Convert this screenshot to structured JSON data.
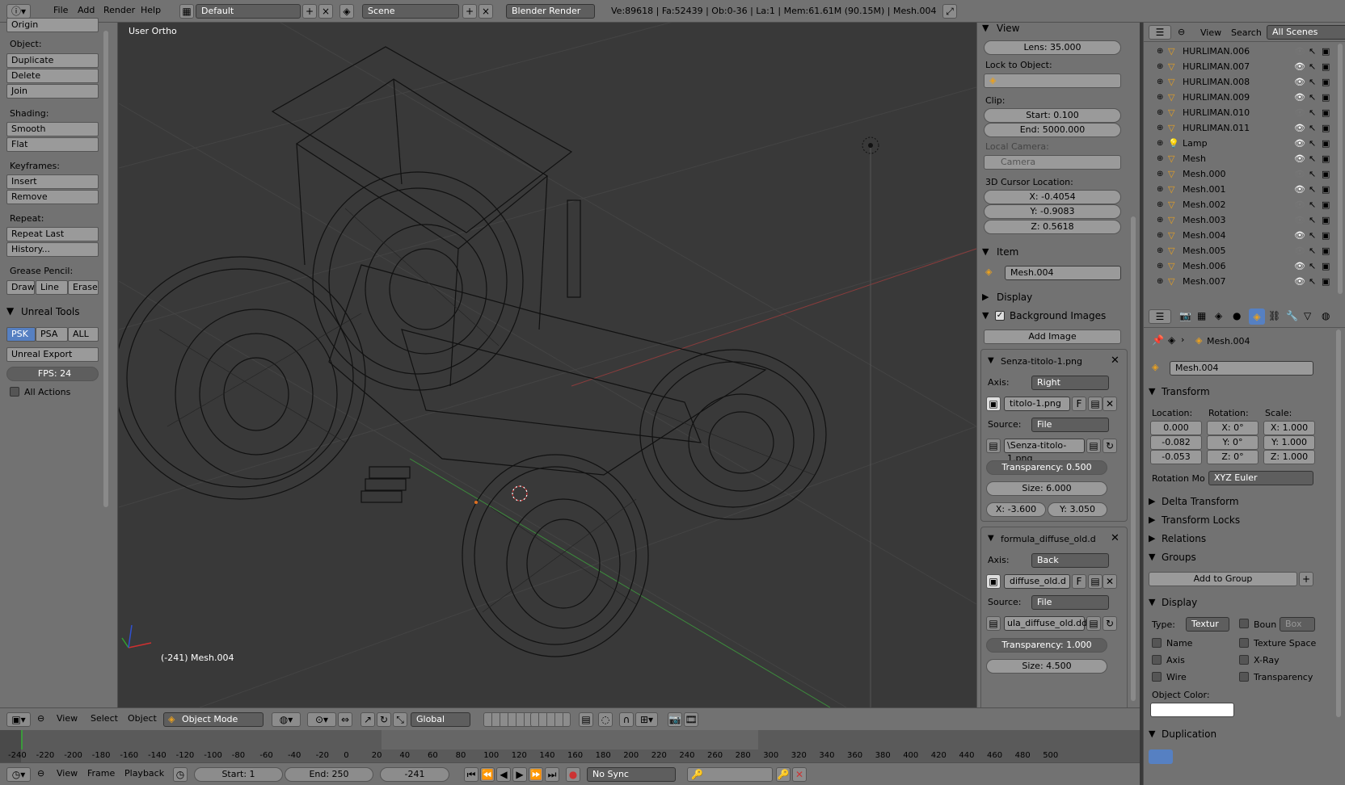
{
  "topbar": {
    "menus": [
      "File",
      "Add",
      "Render",
      "Help"
    ],
    "layout": "Default",
    "scene": "Scene",
    "engine": "Blender Render",
    "stats": "Ve:89618 | Fa:52439 | Ob:0-36 | La:1 | Mem:61.61M (90.15M) | Mesh.004"
  },
  "toolshelf": {
    "top_button": "Origin",
    "object_label": "Object:",
    "object_buttons": [
      "Duplicate",
      "Delete",
      "Join"
    ],
    "shading_label": "Shading:",
    "shading_buttons": [
      "Smooth",
      "Flat"
    ],
    "keyframes_label": "Keyframes:",
    "keyframe_buttons": [
      "Insert",
      "Remove"
    ],
    "repeat_label": "Repeat:",
    "repeat_buttons": [
      "Repeat Last",
      "History..."
    ],
    "grease_label": "Grease Pencil:",
    "grease_buttons": [
      "Draw",
      "Line",
      "Erase"
    ],
    "unreal_title": "Unreal Tools",
    "unreal_tabs": [
      "PSK",
      "PSA",
      "ALL"
    ],
    "unreal_export": "Unreal Export",
    "fps": "FPS: 24",
    "all_actions": "All Actions"
  },
  "viewport": {
    "view_name": "User Ortho",
    "object_info": "(-241) Mesh.004"
  },
  "npanel": {
    "view_title": "View",
    "lens": "Lens: 35.000",
    "lock_label": "Lock to Object:",
    "clip_label": "Clip:",
    "clip_start": "Start: 0.100",
    "clip_end": "End: 5000.000",
    "local_camera_label": "Local Camera:",
    "camera": "Camera",
    "cursor_label": "3D Cursor Location:",
    "cursor_x": "X: -0.4054",
    "cursor_y": "Y: -0.9083",
    "cursor_z": "Z: 0.5618",
    "item_title": "Item",
    "item_name": "Mesh.004",
    "display_title": "Display",
    "bg_title": "Background Images",
    "add_image": "Add Image",
    "bg1": {
      "name": "Senza-titolo-1.png",
      "axis_label": "Axis:",
      "axis": "Right",
      "image": "titolo-1.png",
      "f": "F",
      "source_label": "Source:",
      "source": "File",
      "path": "\\Senza-titolo-1.png",
      "transparency": "Transparency: 0.500",
      "size": "Size: 6.000",
      "x": "X: -3.600",
      "y": "Y: 3.050"
    },
    "bg2": {
      "name": "formula_diffuse_old.d",
      "axis_label": "Axis:",
      "axis": "Back",
      "image": "diffuse_old.d",
      "f": "F",
      "source_label": "Source:",
      "source": "File",
      "path": "ula_diffuse_old.dds",
      "transparency": "Transparency: 1.000",
      "size": "Size: 4.500"
    }
  },
  "outliner": {
    "menus": [
      "View",
      "Search"
    ],
    "filter": "All Scenes",
    "items": [
      {
        "name": "HURLIMAN.006",
        "icon": "mesh-object-icon",
        "visible": false
      },
      {
        "name": "HURLIMAN.007",
        "icon": "mesh-object-icon",
        "visible": true
      },
      {
        "name": "HURLIMAN.008",
        "icon": "mesh-object-icon",
        "visible": true
      },
      {
        "name": "HURLIMAN.009",
        "icon": "mesh-object-icon",
        "visible": true
      },
      {
        "name": "HURLIMAN.010",
        "icon": "mesh-object-icon",
        "visible": false
      },
      {
        "name": "HURLIMAN.011",
        "icon": "mesh-object-icon",
        "visible": true
      },
      {
        "name": "Lamp",
        "icon": "lamp-icon",
        "visible": true
      },
      {
        "name": "Mesh",
        "icon": "mesh-object-icon",
        "visible": true
      },
      {
        "name": "Mesh.000",
        "icon": "mesh-object-icon",
        "visible": false
      },
      {
        "name": "Mesh.001",
        "icon": "mesh-object-icon",
        "visible": true
      },
      {
        "name": "Mesh.002",
        "icon": "mesh-object-icon",
        "visible": false
      },
      {
        "name": "Mesh.003",
        "icon": "mesh-object-icon",
        "visible": false
      },
      {
        "name": "Mesh.004",
        "icon": "mesh-object-icon",
        "visible": true
      },
      {
        "name": "Mesh.005",
        "icon": "mesh-object-icon",
        "visible": false
      },
      {
        "name": "Mesh.006",
        "icon": "mesh-object-icon",
        "visible": true
      },
      {
        "name": "Mesh.007",
        "icon": "mesh-object-icon",
        "visible": true
      }
    ]
  },
  "properties": {
    "breadcrumb": "Mesh.004",
    "object_name": "Mesh.004",
    "transform_title": "Transform",
    "location_label": "Location:",
    "rotation_label": "Rotation:",
    "scale_label": "Scale:",
    "location": [
      "0.000",
      "-0.082",
      "-0.053"
    ],
    "rotation": [
      "X: 0°",
      "Y: 0°",
      "Z: 0°"
    ],
    "scale": [
      "X: 1.000",
      "Y: 1.000",
      "Z: 1.000"
    ],
    "rotation_mode_label": "Rotation Mo",
    "rotation_mode": "XYZ Euler",
    "delta_title": "Delta Transform",
    "locks_title": "Transform Locks",
    "relations_title": "Relations",
    "groups_title": "Groups",
    "add_to_group": "Add to Group",
    "display_title": "Display",
    "type_label": "Type:",
    "type_value": "Textur",
    "bounds_label": "Boun",
    "bounds_value": "Box",
    "name_check": "Name",
    "texture_space": "Texture Space",
    "axis_check": "Axis",
    "xray_check": "X-Ray",
    "wire_check": "Wire",
    "transparency_check": "Transparency",
    "object_color_label": "Object Color:",
    "duplication_title": "Duplication"
  },
  "view_header": {
    "menus": [
      "View",
      "Select",
      "Object"
    ],
    "mode": "Object Mode",
    "orientation": "Global"
  },
  "timeline": {
    "ticks": [
      "-240",
      "-220",
      "-200",
      "-180",
      "-160",
      "-140",
      "-120",
      "-100",
      "-80",
      "-60",
      "-40",
      "-20",
      "0",
      "20",
      "40",
      "60",
      "80",
      "100",
      "120",
      "140",
      "160",
      "180",
      "200",
      "220",
      "240",
      "260",
      "280",
      "300",
      "320",
      "340",
      "360",
      "380",
      "400",
      "420",
      "440",
      "460",
      "480",
      "500"
    ],
    "menus": [
      "View",
      "Frame",
      "Playback"
    ],
    "start": "Start: 1",
    "end": "End: 250",
    "current": "-241",
    "sync": "No Sync"
  }
}
